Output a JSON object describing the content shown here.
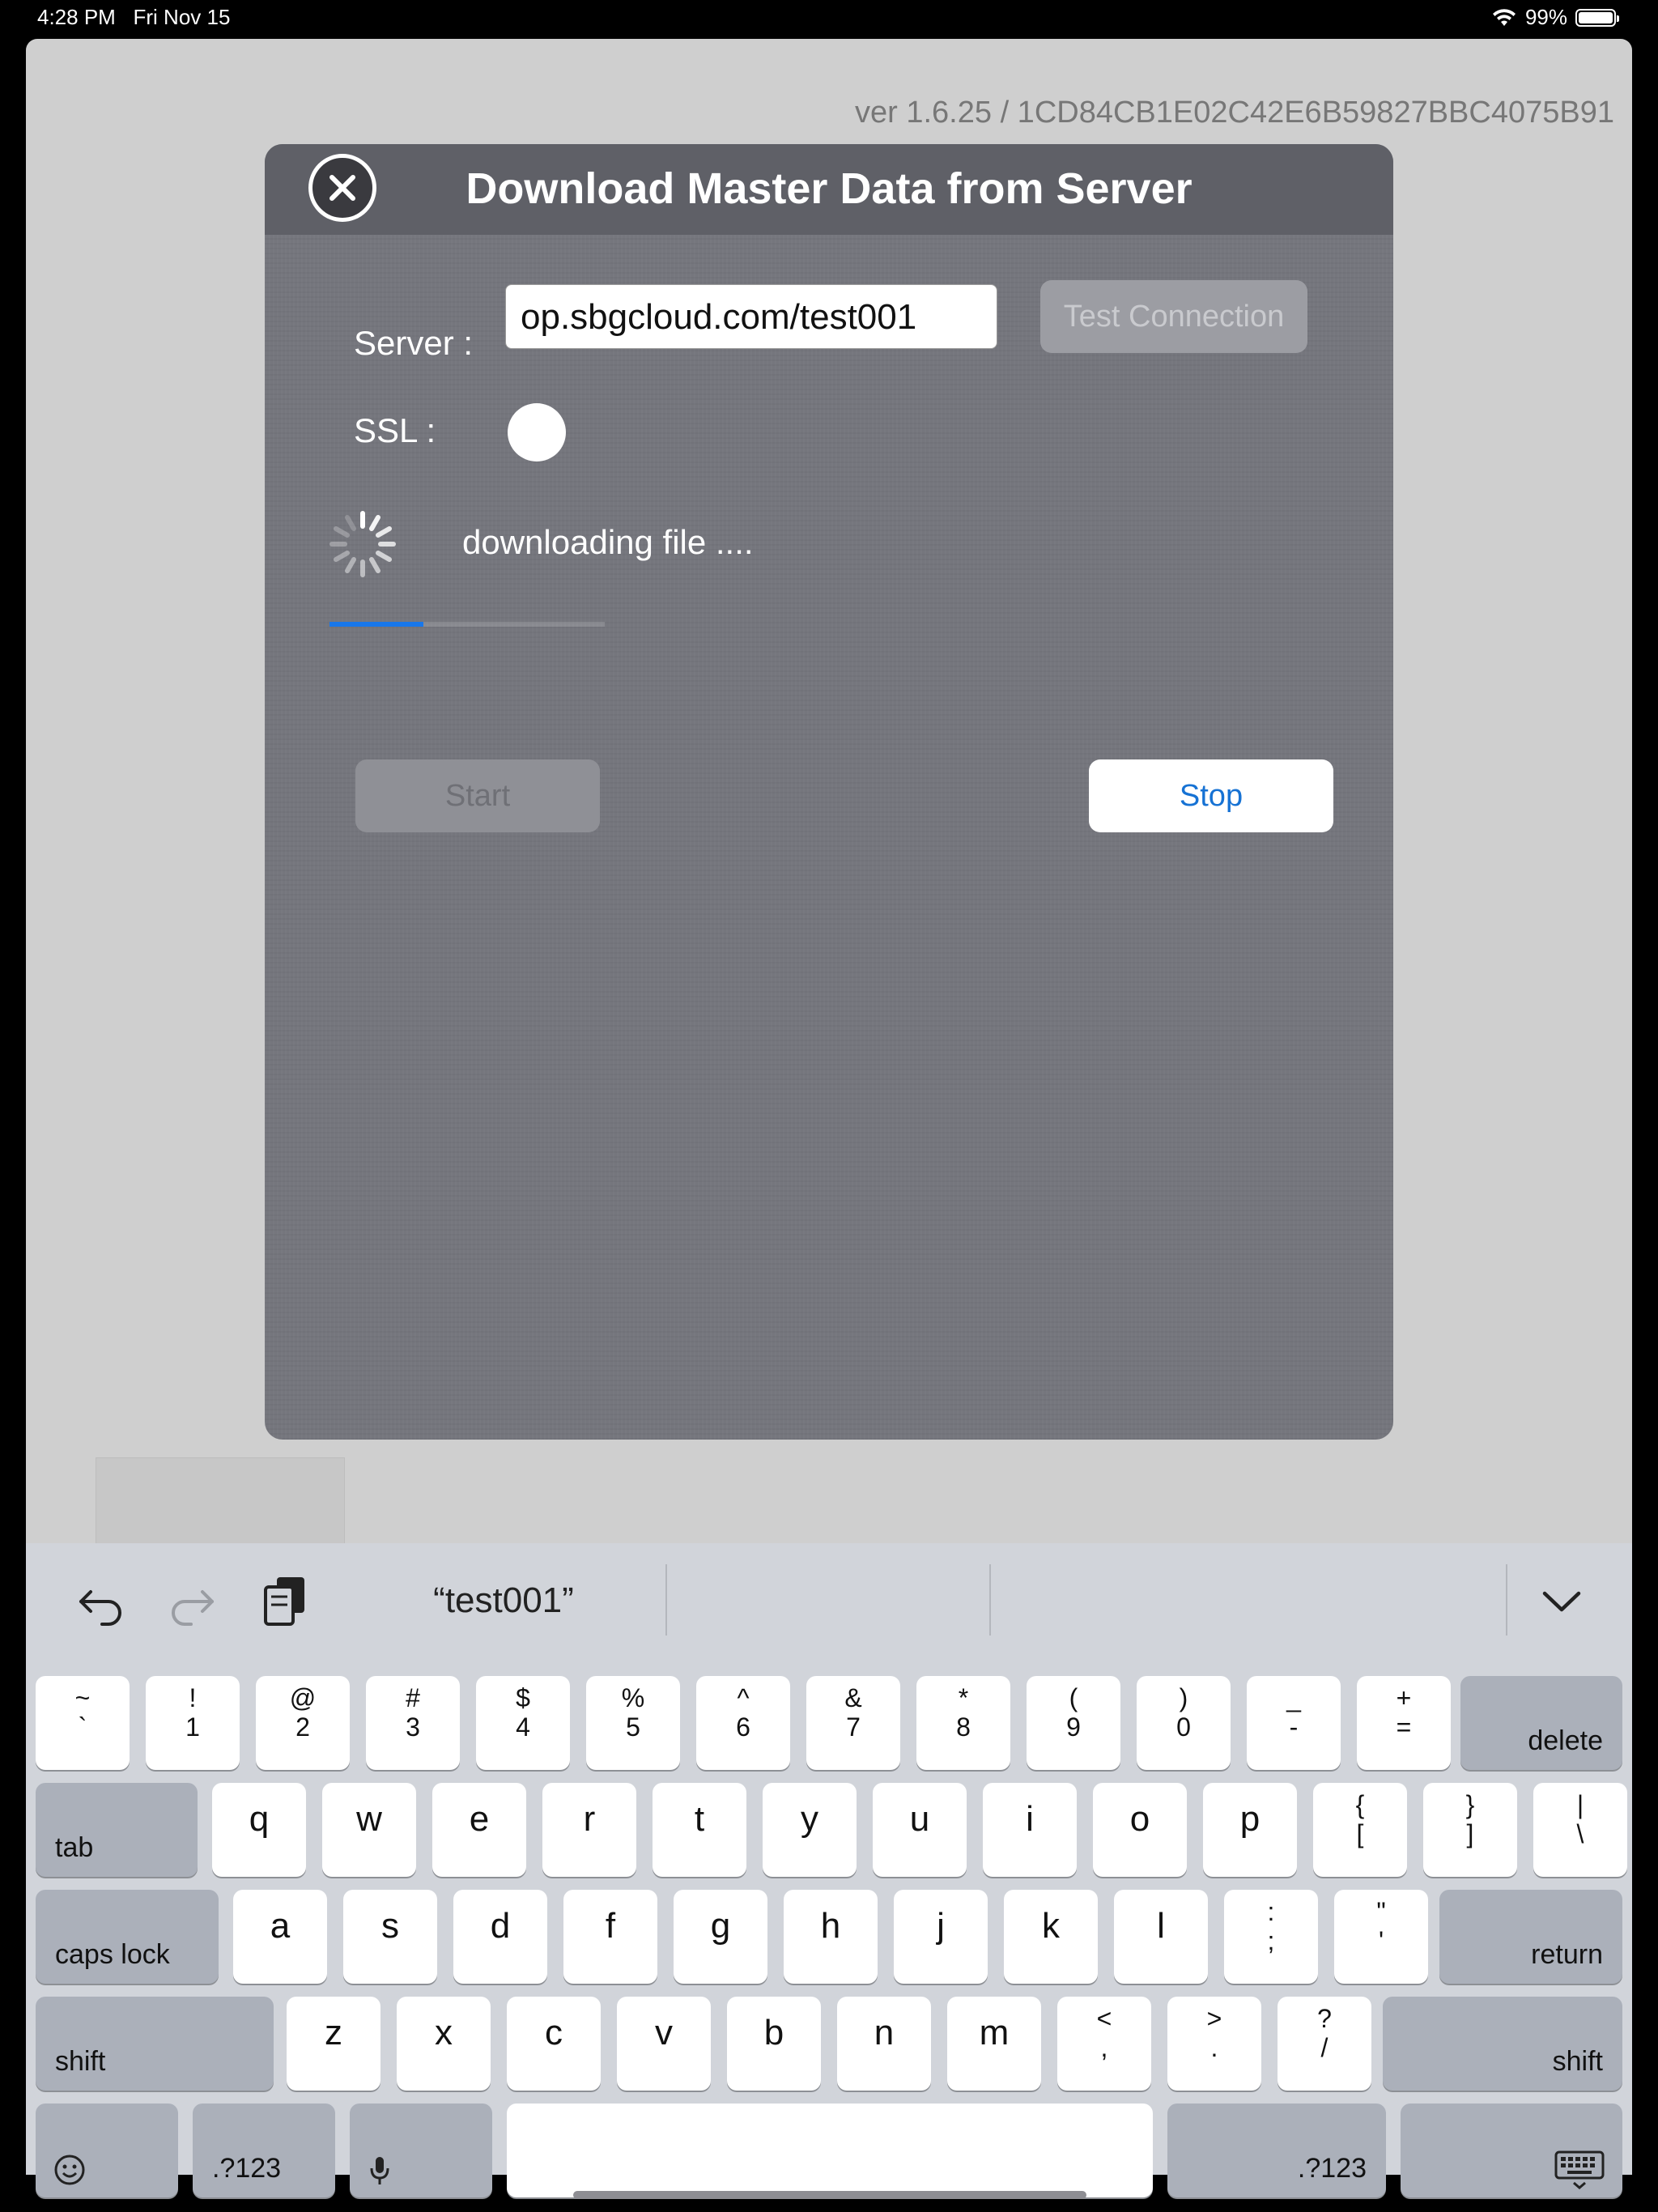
{
  "status_bar": {
    "time": "4:28 PM",
    "date": "Fri Nov 15",
    "battery": "99%"
  },
  "app": {
    "version": "ver 1.6.25 / 1CD84CB1E02C42E6B59827BBC4075B91"
  },
  "dialog": {
    "title": "Download Master Data from Server",
    "server_label": "Server :",
    "server_value": "op.sbgcloud.com/test001",
    "test_connection_label": "Test Connection",
    "ssl_label": "SSL :",
    "status_text": "downloading file ....",
    "progress": 0.34,
    "start_label": "Start",
    "stop_label": "Stop",
    "colors": {
      "progress": "#1877ea",
      "stop_text": "#1672d4"
    }
  },
  "keyboard": {
    "suggestion": "“test001”",
    "number_row": [
      {
        "top": "~",
        "bottom": "`"
      },
      {
        "top": "!",
        "bottom": "1"
      },
      {
        "top": "@",
        "bottom": "2"
      },
      {
        "top": "#",
        "bottom": "3"
      },
      {
        "top": "$",
        "bottom": "4"
      },
      {
        "top": "%",
        "bottom": "5"
      },
      {
        "top": "^",
        "bottom": "6"
      },
      {
        "top": "&",
        "bottom": "7"
      },
      {
        "top": "*",
        "bottom": "8"
      },
      {
        "top": "(",
        "bottom": "9"
      },
      {
        "top": ")",
        "bottom": "0"
      },
      {
        "top": "_",
        "bottom": "-"
      },
      {
        "top": "+",
        "bottom": "="
      }
    ],
    "delete_label": "delete",
    "tab_label": "tab",
    "row_q": [
      "q",
      "w",
      "e",
      "r",
      "t",
      "y",
      "u",
      "i",
      "o",
      "p"
    ],
    "row_q_extra": [
      {
        "top": "{",
        "bottom": "["
      },
      {
        "top": "}",
        "bottom": "]"
      },
      {
        "top": "|",
        "bottom": "\\"
      }
    ],
    "caps_label": "caps lock",
    "row_a": [
      "a",
      "s",
      "d",
      "f",
      "g",
      "h",
      "j",
      "k",
      "l"
    ],
    "row_a_extra": [
      {
        "top": ":",
        "bottom": ";"
      },
      {
        "top": "\"",
        "bottom": "'"
      }
    ],
    "return_label": "return",
    "shift_label": "shift",
    "row_z": [
      "z",
      "x",
      "c",
      "v",
      "b",
      "n",
      "m"
    ],
    "row_z_extra": [
      {
        "top": "<",
        "bottom": ","
      },
      {
        "top": ">",
        "bottom": "."
      },
      {
        "top": "?",
        "bottom": "/"
      }
    ],
    "numbers_label": ".?123",
    "icons": [
      "undo-icon",
      "redo-icon",
      "clipboard-icon",
      "chevron-down-icon",
      "emoji-icon",
      "microphone-icon",
      "keyboard-dismiss-icon"
    ]
  }
}
